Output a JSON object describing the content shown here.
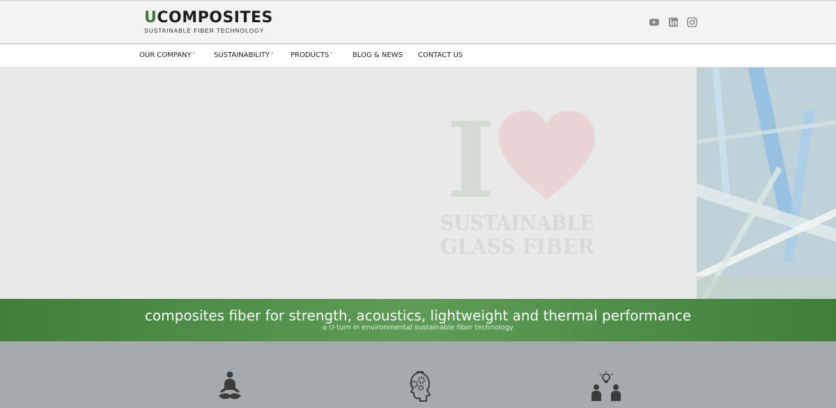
{
  "header": {
    "logo": {
      "brand_u": "U",
      "brand_rest": "COMPOSITES",
      "tagline": "SUSTAINABLE FIBER TECHNOLOGY"
    },
    "social": [
      {
        "name": "youtube-icon"
      },
      {
        "name": "linkedin-icon"
      },
      {
        "name": "instagram-icon"
      }
    ]
  },
  "nav": {
    "items": [
      {
        "label": "OUR COMPANY",
        "chevron": "˅"
      },
      {
        "label": "SUSTAINABILITY",
        "chevron": "˅"
      },
      {
        "label": "PRODUCTS",
        "chevron": "˅"
      },
      {
        "label": "BLOG & NEWS"
      },
      {
        "label": "CONTACT US"
      }
    ]
  },
  "hero": {
    "graphic": {
      "letter": "I",
      "line1": "SUSTAINABLE",
      "line2": "GLASS FIBER"
    }
  },
  "banner": {
    "title": "composites fiber for strength, acoustics, lightweight and thermal performance",
    "subtitle": "a U-turn in environmental sustainable fiber technology"
  },
  "features": {
    "icons": [
      "meditation-person-icon",
      "brain-gears-icon",
      "team-idea-icon"
    ]
  },
  "colors": {
    "brand_green": "#3d7a36",
    "banner_green": "#4c8a46",
    "header_bg": "#f3f3f3",
    "hero_bg": "#e9e9e9",
    "features_bg": "#a7aaad"
  }
}
